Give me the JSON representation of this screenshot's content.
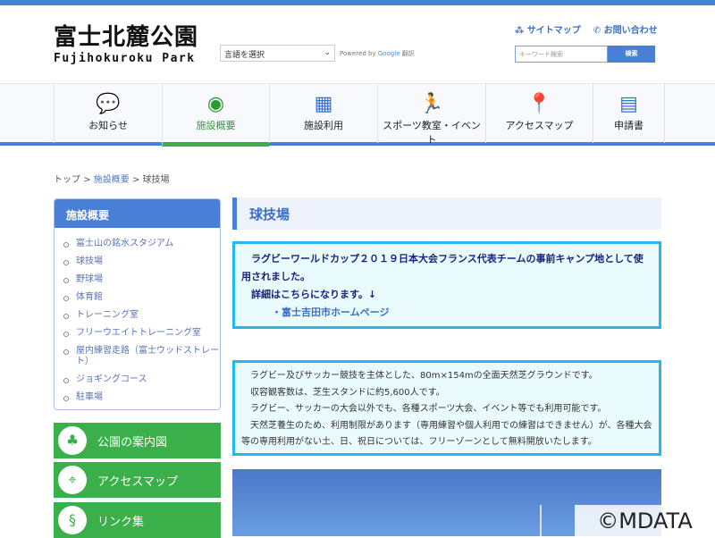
{
  "header": {
    "logo_jp": "富士北麓公園",
    "logo_en": "Fujihokuroku  Park",
    "language_select": "言語を選択",
    "powered_by": "Powered by",
    "google": "Google",
    "translate": "翻訳",
    "sitemap": "サイトマップ",
    "contact": "お問い合わせ",
    "search_placeholder": "キーワード検索",
    "search_button": "検索"
  },
  "nav": [
    {
      "label": "お知らせ",
      "icon": "chat-icon"
    },
    {
      "label": "施設概要",
      "icon": "stadium-icon"
    },
    {
      "label": "施設利用",
      "icon": "calendar-icon"
    },
    {
      "label": "スポーツ教室・イベント",
      "icon": "runner-icon"
    },
    {
      "label": "アクセスマップ",
      "icon": "map-pin-icon"
    },
    {
      "label": "申請書",
      "icon": "document-icon"
    }
  ],
  "breadcrumb": {
    "top": "トップ",
    "parent": "施設概要",
    "current": "球技場",
    "sep": ">"
  },
  "sidebar": {
    "title": "施設概要",
    "items": [
      "富士山の銘水スタジアム",
      "球技場",
      "野球場",
      "体育館",
      "トレーニング室",
      "フリーウエイトトレーニング室",
      "屋内練習走路（富士ウッドストレート）",
      "ジョギングコース",
      "駐車場"
    ]
  },
  "side_buttons": [
    "公園の案内図",
    "アクセスマップ",
    "リンク集"
  ],
  "main": {
    "title": "球技場",
    "notice_line1": "　ラグビーワールドカップ２０１９日本大会フランス代表チームの事前キャンプ地として使用されました。",
    "notice_line2": "　詳細はこちらになります。↓",
    "notice_link": "・富士吉田市ホームページ",
    "desc": [
      "　ラグビー及びサッカー競技を主体とした、80m×154mの全面天然芝グラウンドです。",
      "　収容観客数は、芝生スタンドに約5,600人です。",
      "　ラグビー、サッカーの大会以外でも、各種スポーツ大会、イベント等でも利用可能です。",
      "　天然芝養生のため、利用制限があります（専用練習や個人利用での練習はできません）が、各種大会等の専用利用がない土、日、祝日については、フリーゾーンとして無料開放いたします。"
    ]
  },
  "watermark": "©MDATA"
}
